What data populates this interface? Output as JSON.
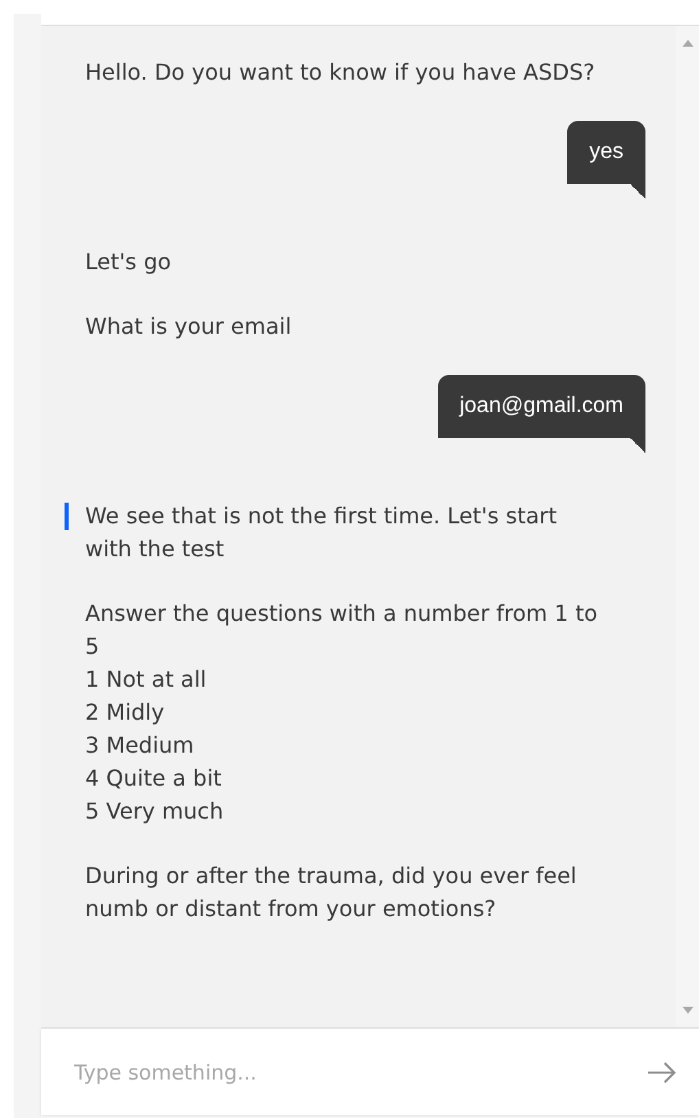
{
  "messages": [
    {
      "kind": "bot",
      "focused": false,
      "paragraphs": [
        "Hello. Do you want to know if you have ASDS?"
      ]
    },
    {
      "kind": "user",
      "text": "yes"
    },
    {
      "kind": "bot",
      "focused": false,
      "paragraphs": [
        "Let's go",
        "What is your email"
      ]
    },
    {
      "kind": "user",
      "text": "joan@gmail.com"
    },
    {
      "kind": "bot",
      "focused": true,
      "paragraphs": [
        "We see that is not the first time. Let's start with the test",
        "Answer the questions with a number from 1 to 5\n1 Not at all\n2 Midly\n3 Medium\n4 Quite a bit\n5 Very much",
        "During or after the trauma, did you ever feel numb or distant from your emotions?"
      ]
    }
  ],
  "composer": {
    "placeholder": "Type something..."
  }
}
